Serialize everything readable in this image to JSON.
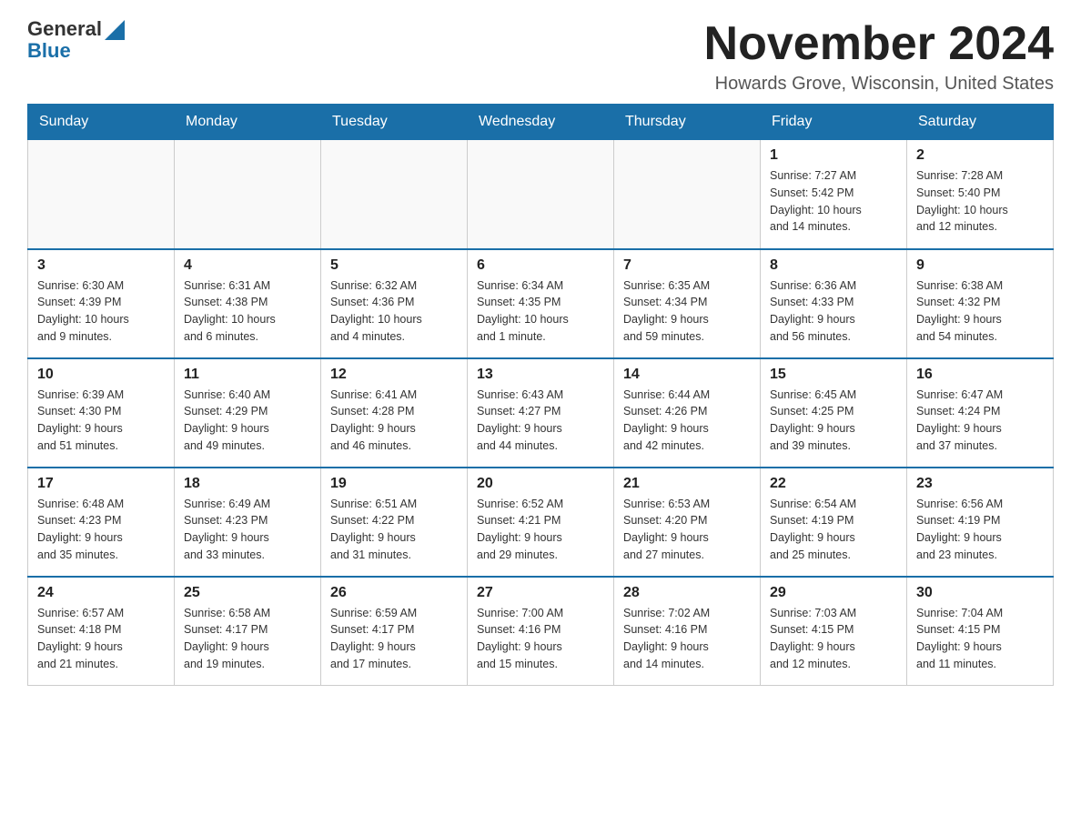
{
  "header": {
    "logo_general": "General",
    "logo_blue": "Blue",
    "month_title": "November 2024",
    "location": "Howards Grove, Wisconsin, United States"
  },
  "days_of_week": [
    "Sunday",
    "Monday",
    "Tuesday",
    "Wednesday",
    "Thursday",
    "Friday",
    "Saturday"
  ],
  "weeks": [
    [
      {
        "day": "",
        "info": ""
      },
      {
        "day": "",
        "info": ""
      },
      {
        "day": "",
        "info": ""
      },
      {
        "day": "",
        "info": ""
      },
      {
        "day": "",
        "info": ""
      },
      {
        "day": "1",
        "info": "Sunrise: 7:27 AM\nSunset: 5:42 PM\nDaylight: 10 hours\nand 14 minutes."
      },
      {
        "day": "2",
        "info": "Sunrise: 7:28 AM\nSunset: 5:40 PM\nDaylight: 10 hours\nand 12 minutes."
      }
    ],
    [
      {
        "day": "3",
        "info": "Sunrise: 6:30 AM\nSunset: 4:39 PM\nDaylight: 10 hours\nand 9 minutes."
      },
      {
        "day": "4",
        "info": "Sunrise: 6:31 AM\nSunset: 4:38 PM\nDaylight: 10 hours\nand 6 minutes."
      },
      {
        "day": "5",
        "info": "Sunrise: 6:32 AM\nSunset: 4:36 PM\nDaylight: 10 hours\nand 4 minutes."
      },
      {
        "day": "6",
        "info": "Sunrise: 6:34 AM\nSunset: 4:35 PM\nDaylight: 10 hours\nand 1 minute."
      },
      {
        "day": "7",
        "info": "Sunrise: 6:35 AM\nSunset: 4:34 PM\nDaylight: 9 hours\nand 59 minutes."
      },
      {
        "day": "8",
        "info": "Sunrise: 6:36 AM\nSunset: 4:33 PM\nDaylight: 9 hours\nand 56 minutes."
      },
      {
        "day": "9",
        "info": "Sunrise: 6:38 AM\nSunset: 4:32 PM\nDaylight: 9 hours\nand 54 minutes."
      }
    ],
    [
      {
        "day": "10",
        "info": "Sunrise: 6:39 AM\nSunset: 4:30 PM\nDaylight: 9 hours\nand 51 minutes."
      },
      {
        "day": "11",
        "info": "Sunrise: 6:40 AM\nSunset: 4:29 PM\nDaylight: 9 hours\nand 49 minutes."
      },
      {
        "day": "12",
        "info": "Sunrise: 6:41 AM\nSunset: 4:28 PM\nDaylight: 9 hours\nand 46 minutes."
      },
      {
        "day": "13",
        "info": "Sunrise: 6:43 AM\nSunset: 4:27 PM\nDaylight: 9 hours\nand 44 minutes."
      },
      {
        "day": "14",
        "info": "Sunrise: 6:44 AM\nSunset: 4:26 PM\nDaylight: 9 hours\nand 42 minutes."
      },
      {
        "day": "15",
        "info": "Sunrise: 6:45 AM\nSunset: 4:25 PM\nDaylight: 9 hours\nand 39 minutes."
      },
      {
        "day": "16",
        "info": "Sunrise: 6:47 AM\nSunset: 4:24 PM\nDaylight: 9 hours\nand 37 minutes."
      }
    ],
    [
      {
        "day": "17",
        "info": "Sunrise: 6:48 AM\nSunset: 4:23 PM\nDaylight: 9 hours\nand 35 minutes."
      },
      {
        "day": "18",
        "info": "Sunrise: 6:49 AM\nSunset: 4:23 PM\nDaylight: 9 hours\nand 33 minutes."
      },
      {
        "day": "19",
        "info": "Sunrise: 6:51 AM\nSunset: 4:22 PM\nDaylight: 9 hours\nand 31 minutes."
      },
      {
        "day": "20",
        "info": "Sunrise: 6:52 AM\nSunset: 4:21 PM\nDaylight: 9 hours\nand 29 minutes."
      },
      {
        "day": "21",
        "info": "Sunrise: 6:53 AM\nSunset: 4:20 PM\nDaylight: 9 hours\nand 27 minutes."
      },
      {
        "day": "22",
        "info": "Sunrise: 6:54 AM\nSunset: 4:19 PM\nDaylight: 9 hours\nand 25 minutes."
      },
      {
        "day": "23",
        "info": "Sunrise: 6:56 AM\nSunset: 4:19 PM\nDaylight: 9 hours\nand 23 minutes."
      }
    ],
    [
      {
        "day": "24",
        "info": "Sunrise: 6:57 AM\nSunset: 4:18 PM\nDaylight: 9 hours\nand 21 minutes."
      },
      {
        "day": "25",
        "info": "Sunrise: 6:58 AM\nSunset: 4:17 PM\nDaylight: 9 hours\nand 19 minutes."
      },
      {
        "day": "26",
        "info": "Sunrise: 6:59 AM\nSunset: 4:17 PM\nDaylight: 9 hours\nand 17 minutes."
      },
      {
        "day": "27",
        "info": "Sunrise: 7:00 AM\nSunset: 4:16 PM\nDaylight: 9 hours\nand 15 minutes."
      },
      {
        "day": "28",
        "info": "Sunrise: 7:02 AM\nSunset: 4:16 PM\nDaylight: 9 hours\nand 14 minutes."
      },
      {
        "day": "29",
        "info": "Sunrise: 7:03 AM\nSunset: 4:15 PM\nDaylight: 9 hours\nand 12 minutes."
      },
      {
        "day": "30",
        "info": "Sunrise: 7:04 AM\nSunset: 4:15 PM\nDaylight: 9 hours\nand 11 minutes."
      }
    ]
  ]
}
